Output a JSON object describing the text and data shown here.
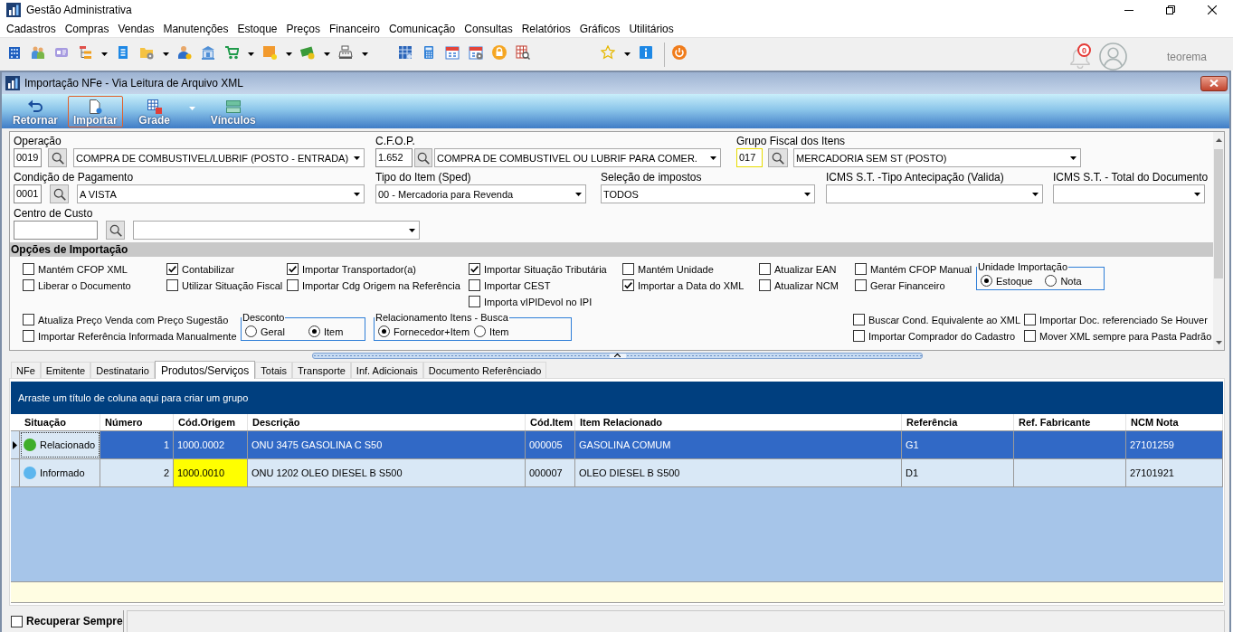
{
  "app": {
    "title": "Gestão Administrativa"
  },
  "menu": [
    "Cadastros",
    "Compras",
    "Vendas",
    "Manutenções",
    "Estoque",
    "Preços",
    "Financeiro",
    "Comunicação",
    "Consultas",
    "Relatórios",
    "Gráficos",
    "Utilitários"
  ],
  "header": {
    "notification_count": "0",
    "user_name": "teorema"
  },
  "window": {
    "title": "Importação NFe - Via Leitura de Arquivo XML",
    "actions": [
      {
        "label": "Retornar",
        "kind": "button",
        "selected": false
      },
      {
        "label": "Importar",
        "kind": "button",
        "selected": true
      },
      {
        "label": "Grade",
        "kind": "split",
        "selected": false
      },
      {
        "label": "Vínculos",
        "kind": "button",
        "selected": false
      }
    ]
  },
  "form": {
    "fields": [
      {
        "label": "Operação",
        "kind": "lookup",
        "code": "0019",
        "focused": false,
        "description": "COMPRA DE COMBUSTIVEL/LUBRIF (POSTO - ENTRADA)"
      },
      {
        "label": "C.F.O.P.",
        "kind": "lookup",
        "code": "1.652",
        "focused": false,
        "description": "COMPRA DE COMBUSTIVEL OU LUBRIF PARA COMER."
      },
      {
        "label": "Grupo Fiscal dos Itens",
        "kind": "lookup",
        "code": "017",
        "focused": true,
        "description": "MERCADORIA SEM ST (POSTO)"
      },
      {
        "label": "Condição de Pagamento",
        "kind": "lookup",
        "code": "0001",
        "focused": false,
        "description": "A VISTA"
      },
      {
        "label": "Tipo do Item (Sped)",
        "kind": "combo",
        "value": "00 - Mercadoria para Revenda"
      },
      {
        "label": "Seleção de impostos",
        "kind": "combo",
        "value": "TODOS"
      },
      {
        "label": "ICMS S.T. -Tipo Antecipação (Valida)",
        "kind": "combo"
      },
      {
        "label": "ICMS S.T. - Total do Documento",
        "kind": "combo"
      },
      {
        "label": "Centro de Custo",
        "kind": "lookup",
        "focused": false
      }
    ]
  },
  "options": {
    "title": "Opções de Importação",
    "sections": [
      {
        "kind": "checks",
        "items": [
          {
            "label": "Mantém CFOP XML",
            "checked": false
          },
          {
            "label": "Liberar o Documento",
            "checked": false
          }
        ]
      },
      {
        "kind": "checks",
        "items": [
          {
            "label": "Contabilizar",
            "checked": true
          },
          {
            "label": "Utilizar Situação Fiscal",
            "checked": false
          }
        ]
      },
      {
        "kind": "checks",
        "items": [
          {
            "label": "Importar Transportador(a)",
            "checked": true
          },
          {
            "label": "Importar Cdg Origem na Referência",
            "checked": false
          }
        ]
      },
      {
        "kind": "checks",
        "items": [
          {
            "label": "Importar Situação Tributária",
            "checked": true
          },
          {
            "label": "Importar CEST",
            "checked": false
          },
          {
            "label": "Importa vIPIDevol no IPI",
            "checked": false
          }
        ]
      },
      {
        "kind": "checks",
        "items": [
          {
            "label": "Mantém Unidade",
            "checked": false
          },
          {
            "label": "Importar a Data do XML",
            "checked": true
          }
        ]
      },
      {
        "kind": "checks",
        "items": [
          {
            "label": "Atualizar EAN",
            "checked": false
          },
          {
            "label": "Atualizar NCM",
            "checked": false
          }
        ]
      },
      {
        "kind": "checks",
        "items": [
          {
            "label": "Mantém CFOP Manual",
            "checked": false
          },
          {
            "label": "Gerar Financeiro",
            "checked": false
          }
        ]
      },
      {
        "kind": "radios",
        "title": "Unidade Importação",
        "items": [
          {
            "label": "Estoque",
            "selected": true
          },
          {
            "label": "Nota",
            "selected": false
          }
        ]
      },
      {
        "kind": "checks",
        "items": [
          {
            "label": "Atualiza Preço Venda com Preço Sugestão",
            "checked": false
          },
          {
            "label": "Importar Referência Informada Manualmente",
            "checked": false
          }
        ]
      },
      {
        "kind": "radios",
        "title": "Desconto",
        "items": [
          {
            "label": "Geral",
            "selected": false
          },
          {
            "label": "Item",
            "selected": true
          }
        ]
      },
      {
        "kind": "radios",
        "title": "Relacionamento Itens - Busca",
        "items": [
          {
            "label": "Fornecedor+Item",
            "selected": true
          },
          {
            "label": "Item",
            "selected": false
          }
        ]
      },
      {
        "kind": "checks",
        "items": [
          {
            "label": "Buscar Cond. Equivalente ao XML",
            "checked": false
          },
          {
            "label": "Importar Comprador do Cadastro",
            "checked": false
          }
        ]
      },
      {
        "kind": "checks",
        "items": [
          {
            "label": "Importar Doc. referenciado Se Houver",
            "checked": false
          },
          {
            "label": "Mover XML sempre para Pasta Padrão",
            "checked": false
          }
        ]
      }
    ]
  },
  "tabs": [
    {
      "label": "NFe",
      "selected": false
    },
    {
      "label": "Emitente",
      "selected": false
    },
    {
      "label": "Destinatario",
      "selected": false
    },
    {
      "label": "Produtos/Serviços",
      "selected": true
    },
    {
      "label": "Totais",
      "selected": false
    },
    {
      "label": "Transporte",
      "selected": false
    },
    {
      "label": "Inf. Adicionais",
      "selected": false
    },
    {
      "label": "Documento Referênciado",
      "selected": false
    }
  ],
  "grid": {
    "group_hint": "Arraste um título de coluna aqui para criar um grupo",
    "columns": [
      "Situação",
      "Número",
      "Cód.Origem",
      "Descrição",
      "Cód.Item",
      "Item Relacionado",
      "Referência",
      "Ref. Fabricante",
      "NCM Nota"
    ],
    "rows": [
      {
        "selected": true,
        "status": {
          "label": "Relacionado",
          "color": "#3fae2a"
        },
        "number": "1",
        "origin_code": "1000.0002",
        "origin_code_highlighted": false,
        "description": "ONU 3475 GASOLINA C S50",
        "item_code": "000005",
        "related_item": "GASOLINA COMUM",
        "reference": "G1",
        "ncm": "27101259"
      },
      {
        "selected": false,
        "status": {
          "label": "Informado",
          "color": "#5cb6ee"
        },
        "number": "2",
        "origin_code": "1000.0010",
        "origin_code_highlighted": true,
        "description": "ONU 1202 OLEO DIESEL B S500",
        "item_code": "000007",
        "related_item": "OLEO DIESEL B S500",
        "reference": "D1",
        "ncm": "27101921"
      }
    ]
  },
  "status_bar": {
    "label": "Recuperar Sempre",
    "checked": false
  }
}
